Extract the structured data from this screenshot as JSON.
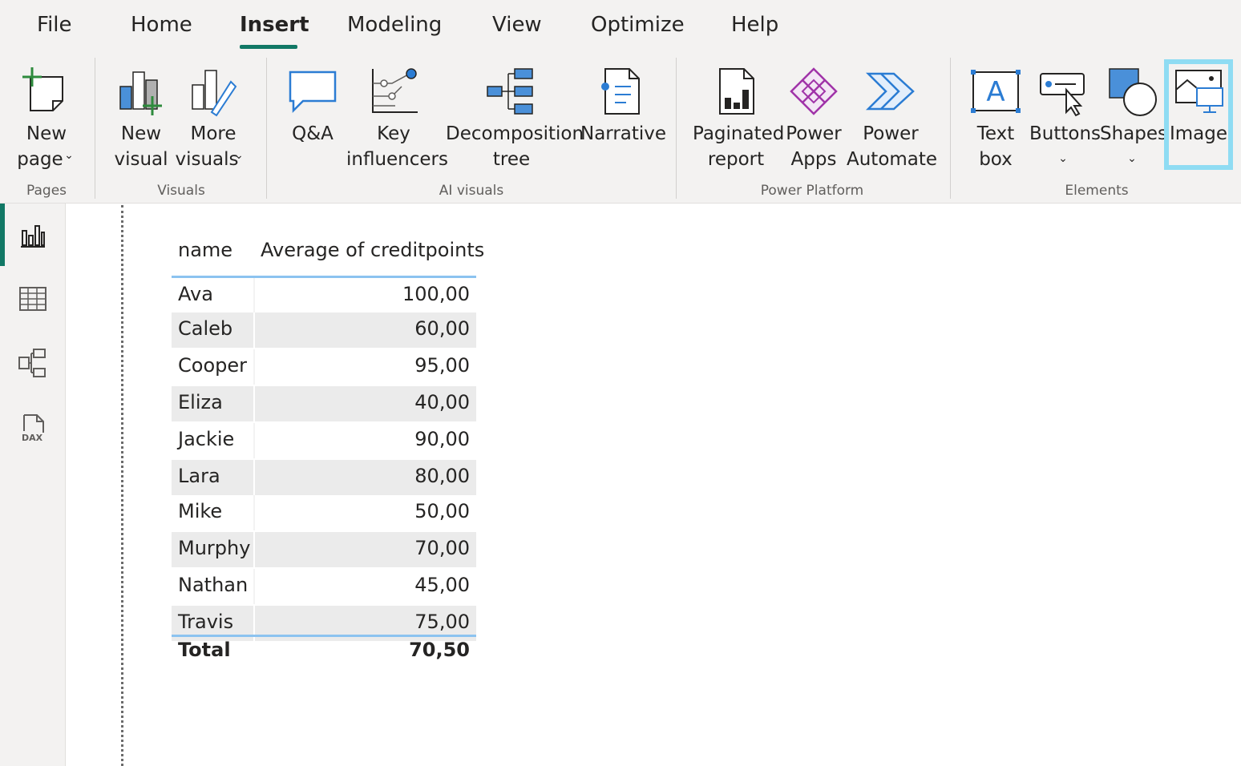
{
  "menu": {
    "tabs": [
      "File",
      "Home",
      "Insert",
      "Modeling",
      "View",
      "Optimize",
      "Help"
    ],
    "active": "Insert"
  },
  "ribbon": {
    "pages": {
      "new_page": [
        "New",
        "page"
      ],
      "group": "Pages"
    },
    "visuals": {
      "new_visual": [
        "New",
        "visual"
      ],
      "more_visuals": [
        "More",
        "visuals"
      ],
      "group": "Visuals"
    },
    "ai": {
      "qa": "Q&A",
      "key_influencers": [
        "Key",
        "influencers"
      ],
      "decomposition": [
        "Decomposition",
        "tree"
      ],
      "narrative": "Narrative",
      "group": "AI visuals"
    },
    "power": {
      "paginated": [
        "Paginated",
        "report"
      ],
      "apps": [
        "Power",
        "Apps"
      ],
      "automate": [
        "Power",
        "Automate"
      ],
      "group": "Power Platform"
    },
    "elements": {
      "text_box": [
        "Text",
        "box"
      ],
      "buttons": "Buttons",
      "shapes": "Shapes",
      "image": "Image",
      "group": "Elements"
    },
    "chevron": "⌄"
  },
  "nav": {
    "icons": [
      "report-view-icon",
      "table-view-icon",
      "model-view-icon",
      "dax-query-icon"
    ],
    "dax_text": "DAX"
  },
  "colors": {
    "accent": "#117865",
    "highlight": "#8fdcf3",
    "table_line": "#8cc3f0"
  },
  "table": {
    "columns": [
      "name",
      "Average of creditpoints"
    ],
    "rows": [
      {
        "name": "Ava",
        "value": "100,00"
      },
      {
        "name": "Caleb",
        "value": "60,00"
      },
      {
        "name": "Cooper",
        "value": "95,00"
      },
      {
        "name": "Eliza",
        "value": "40,00"
      },
      {
        "name": "Jackie",
        "value": "90,00"
      },
      {
        "name": "Lara",
        "value": "80,00"
      },
      {
        "name": "Mike",
        "value": "50,00"
      },
      {
        "name": "Murphy",
        "value": "70,00"
      },
      {
        "name": "Nathan",
        "value": "45,00"
      },
      {
        "name": "Travis",
        "value": "75,00"
      }
    ],
    "total_label": "Total",
    "total_value": "70,50"
  }
}
